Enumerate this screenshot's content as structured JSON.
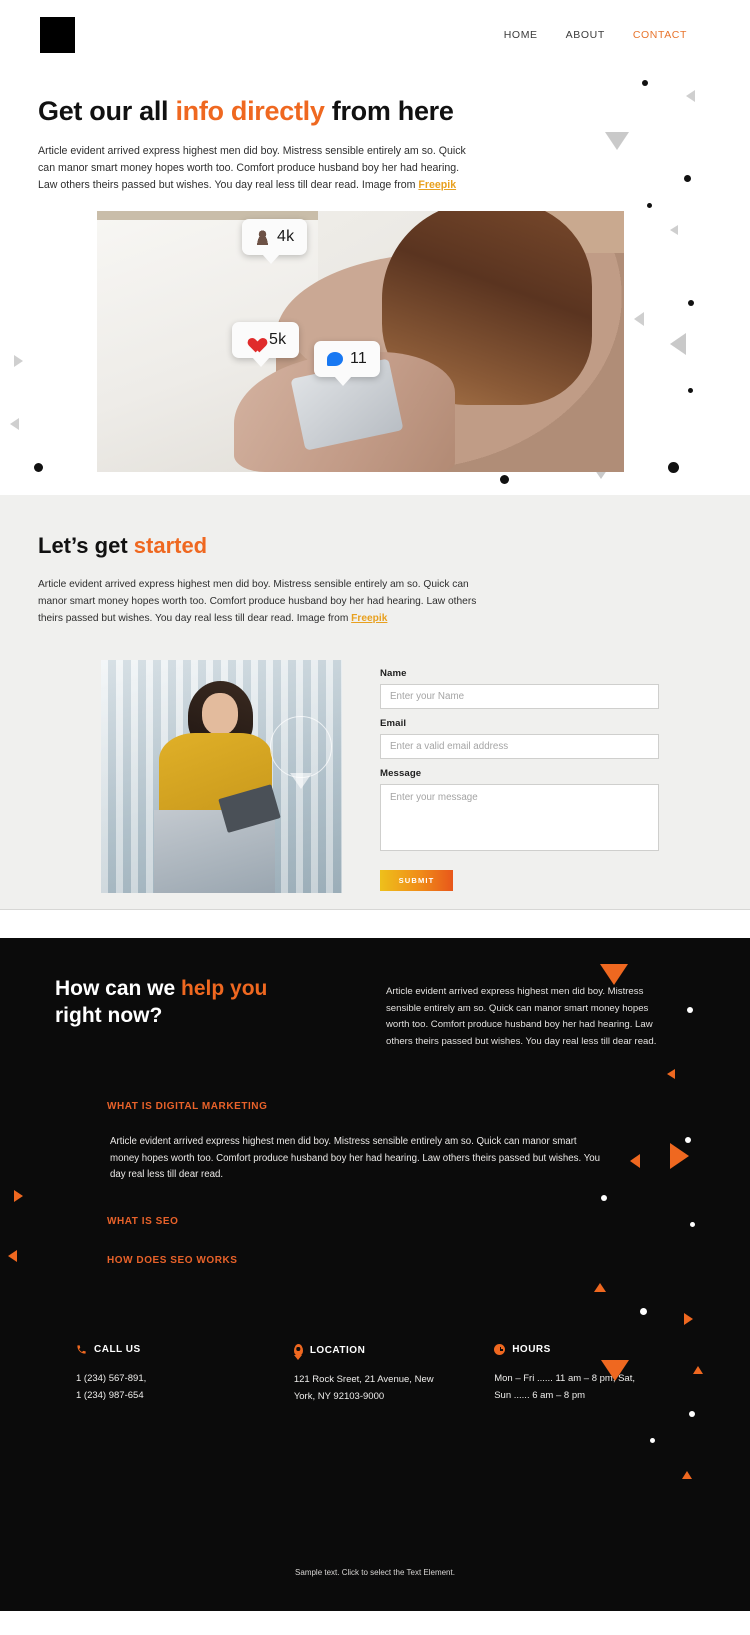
{
  "header": {
    "logo": "logo-mark",
    "nav": [
      {
        "label": "HOME",
        "active": false
      },
      {
        "label": "ABOUT",
        "active": false
      },
      {
        "label": "CONTACT",
        "active": true
      }
    ]
  },
  "hero": {
    "title_pre": "Get our all ",
    "title_accent": "info directly",
    "title_post": " from here",
    "paragraph": "Article evident arrived express highest men did boy. Mistress sensible entirely am so. Quick can manor smart money hopes worth too. Comfort produce husband boy her had hearing. Law others theirs passed but wishes. You day real less till dear read. Image from ",
    "credit": "Freepik",
    "badges": [
      {
        "icon": "person-icon",
        "value": "4k"
      },
      {
        "icon": "heart-icon",
        "value": "5k"
      },
      {
        "icon": "comment-icon",
        "value": "11"
      }
    ]
  },
  "started": {
    "title_pre": "Let’s get ",
    "title_accent": "started",
    "paragraph": "Article evident arrived express highest men did boy. Mistress sensible entirely am so. Quick can manor smart money hopes worth too. Comfort produce husband boy her had hearing. Law others theirs passed but wishes. You day real less till dear read. Image from ",
    "credit": "Freepik",
    "form": {
      "name_label": "Name",
      "name_placeholder": "Enter your Name",
      "name_value": "",
      "email_label": "Email",
      "email_placeholder": "Enter a valid email address",
      "email_value": "",
      "message_label": "Message",
      "message_placeholder": "Enter your message",
      "message_value": "",
      "submit_label": "SUBMIT"
    }
  },
  "dark": {
    "heading_pre": "How can we ",
    "heading_accent": "help you",
    "heading_post": "right now?",
    "lead": "Article evident arrived express highest men did boy. Mistress sensible entirely am so. Quick can manor smart money hopes worth too. Comfort produce husband boy her had hearing. Law others theirs passed but wishes. You day real less till dear read.",
    "accordion": [
      {
        "title": "WHAT IS DIGITAL MARKETING",
        "body": "Article evident arrived express highest men did boy. Mistress sensible entirely am so. Quick can manor smart money hopes worth too. Comfort produce husband boy her had hearing. Law others theirs passed but wishes. You day real less till dear read.",
        "open": true
      },
      {
        "title": "WHAT IS SEO",
        "body": "",
        "open": false
      },
      {
        "title": "HOW DOES SEO WORKS",
        "body": "",
        "open": false
      }
    ],
    "contacts": [
      {
        "icon": "phone-icon",
        "title": "CALL US",
        "line1": "1 (234) 567-891,",
        "line2": "1 (234) 987-654"
      },
      {
        "icon": "location-pin-icon",
        "title": "LOCATION",
        "line1": "121 Rock Sreet, 21 Avenue, New",
        "line2": "York, NY 92103-9000"
      },
      {
        "icon": "clock-icon",
        "title": "HOURS",
        "line1": "Mon – Fri ...... 11 am – 8 pm, Sat,",
        "line2": "Sun  ...... 6 am – 8 pm"
      }
    ],
    "bottom_note": "Sample text. Click to select the Text Element."
  },
  "colors": {
    "accent_orange": "#ef6820",
    "accent_yellow": "#e8a01e",
    "dark_bg": "#0b0b0b",
    "light_bg": "#f0f0ee"
  }
}
